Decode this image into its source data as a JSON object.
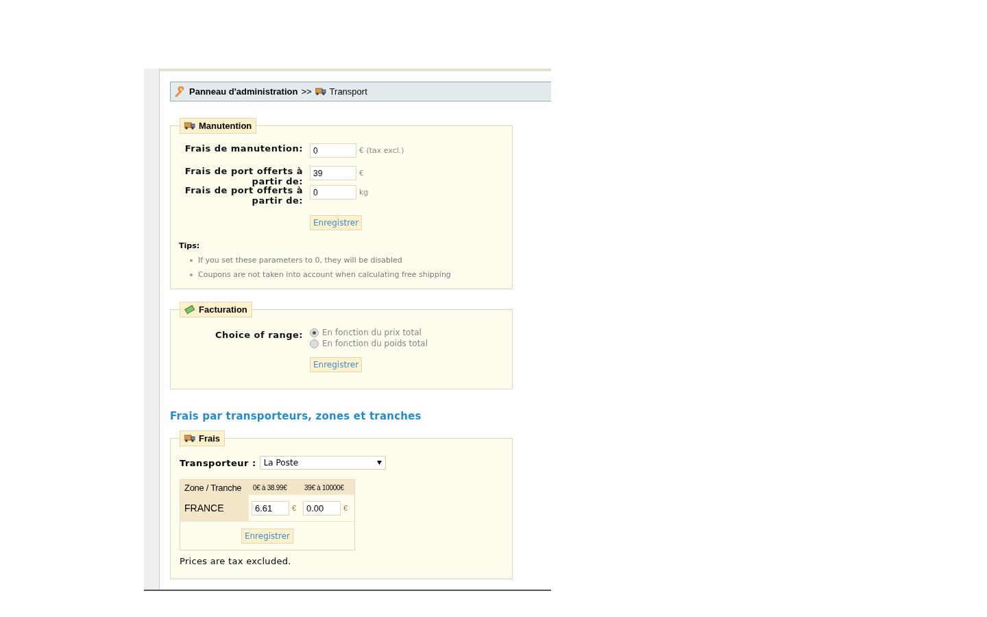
{
  "breadcrumb": {
    "root": "Panneau d'administration",
    "separator": ">>",
    "current": "Transport"
  },
  "handling": {
    "legend": "Manutention",
    "fields": [
      {
        "label": "Frais de manutention:",
        "value": "0",
        "unit": "€ (tax excl.)"
      },
      {
        "label": "Frais de port offerts à partir de:",
        "value": "39",
        "unit": "€"
      },
      {
        "label": "Frais de port offerts à partir de:",
        "value": "0",
        "unit": "kg"
      }
    ],
    "button": "Enregistrer",
    "tips_title": "Tips:",
    "tips": [
      "If you set these parameters to 0, they will be disabled",
      "Coupons are not taken into account when calculating free shipping"
    ]
  },
  "billing": {
    "legend": "Facturation",
    "label": "Choice of range:",
    "options": [
      {
        "label": "En fonction du prix total",
        "selected": true
      },
      {
        "label": "En fonction du poids total",
        "selected": false
      }
    ],
    "button": "Enregistrer"
  },
  "section_title": "Frais par transporteurs, zones et tranches",
  "fees": {
    "legend": "Frais",
    "carrier_label": "Transporteur :",
    "carrier": "La Poste",
    "table": {
      "columns": [
        "Zone / Tranche",
        "0€ à 38.99€",
        "39€ à 10000€"
      ],
      "rows": [
        {
          "cells": [
            {
              "kind": "zone",
              "text": "FRANCE"
            },
            {
              "kind": "price",
              "value": "6.61",
              "unit": "€"
            },
            {
              "kind": "price",
              "value": "0.00",
              "unit": "€"
            }
          ]
        }
      ]
    },
    "button": "Enregistrer",
    "note": "Prices are tax excluded."
  }
}
